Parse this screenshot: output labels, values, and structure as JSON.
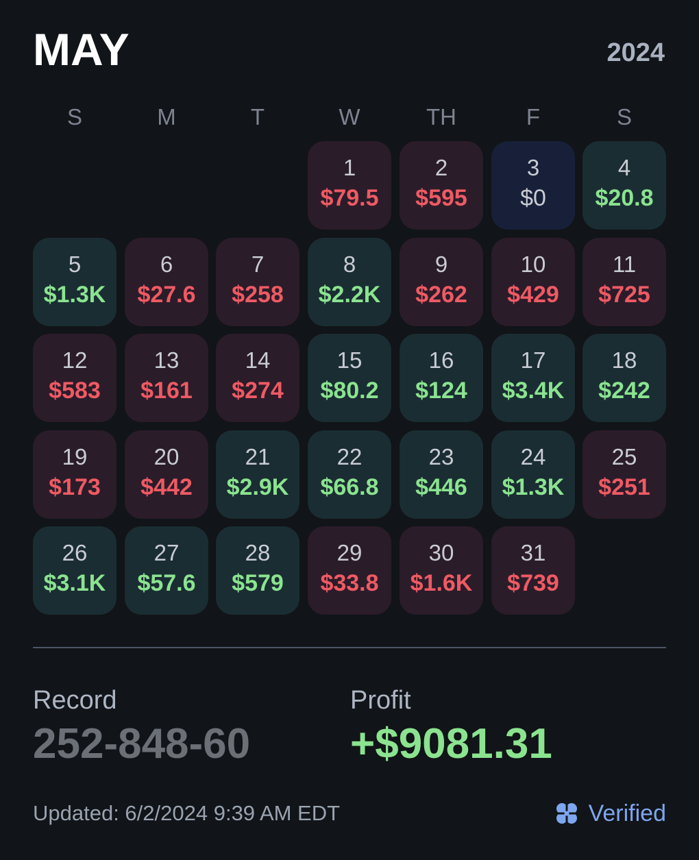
{
  "header": {
    "month": "MAY",
    "year": "2024"
  },
  "weekdays": [
    "S",
    "M",
    "T",
    "W",
    "TH",
    "F",
    "S"
  ],
  "days": [
    {
      "day": "1",
      "amount": "$79.5",
      "status": "loss"
    },
    {
      "day": "2",
      "amount": "$595",
      "status": "loss"
    },
    {
      "day": "3",
      "amount": "$0",
      "status": "even"
    },
    {
      "day": "4",
      "amount": "$20.8",
      "status": "win"
    },
    {
      "day": "5",
      "amount": "$1.3K",
      "status": "win"
    },
    {
      "day": "6",
      "amount": "$27.6",
      "status": "loss"
    },
    {
      "day": "7",
      "amount": "$258",
      "status": "loss"
    },
    {
      "day": "8",
      "amount": "$2.2K",
      "status": "win"
    },
    {
      "day": "9",
      "amount": "$262",
      "status": "loss"
    },
    {
      "day": "10",
      "amount": "$429",
      "status": "loss"
    },
    {
      "day": "11",
      "amount": "$725",
      "status": "loss"
    },
    {
      "day": "12",
      "amount": "$583",
      "status": "loss"
    },
    {
      "day": "13",
      "amount": "$161",
      "status": "loss"
    },
    {
      "day": "14",
      "amount": "$274",
      "status": "loss"
    },
    {
      "day": "15",
      "amount": "$80.2",
      "status": "win"
    },
    {
      "day": "16",
      "amount": "$124",
      "status": "win"
    },
    {
      "day": "17",
      "amount": "$3.4K",
      "status": "win"
    },
    {
      "day": "18",
      "amount": "$242",
      "status": "win"
    },
    {
      "day": "19",
      "amount": "$173",
      "status": "loss"
    },
    {
      "day": "20",
      "amount": "$442",
      "status": "loss"
    },
    {
      "day": "21",
      "amount": "$2.9K",
      "status": "win"
    },
    {
      "day": "22",
      "amount": "$66.8",
      "status": "win"
    },
    {
      "day": "23",
      "amount": "$446",
      "status": "win"
    },
    {
      "day": "24",
      "amount": "$1.3K",
      "status": "win"
    },
    {
      "day": "25",
      "amount": "$251",
      "status": "loss"
    },
    {
      "day": "26",
      "amount": "$3.1K",
      "status": "win"
    },
    {
      "day": "27",
      "amount": "$57.6",
      "status": "win"
    },
    {
      "day": "28",
      "amount": "$579",
      "status": "win"
    },
    {
      "day": "29",
      "amount": "$33.8",
      "status": "loss"
    },
    {
      "day": "30",
      "amount": "$1.6K",
      "status": "loss"
    },
    {
      "day": "31",
      "amount": "$739",
      "status": "loss"
    }
  ],
  "summary": {
    "record_label": "Record",
    "record_value": "252-848-60",
    "profit_label": "Profit",
    "profit_value": "+$9081.31"
  },
  "footer": {
    "updated": "Updated: 6/2/2024 9:39 AM EDT",
    "verified_label": "Verified",
    "verified_icon": "clover-icon"
  },
  "colors": {
    "background": "#111418",
    "win_cell": "#1a2d33",
    "loss_cell": "#2b1c2a",
    "even_cell": "#172038",
    "win_text": "#8be38f",
    "loss_text": "#ef5a63",
    "verified": "#7ea6ee"
  }
}
